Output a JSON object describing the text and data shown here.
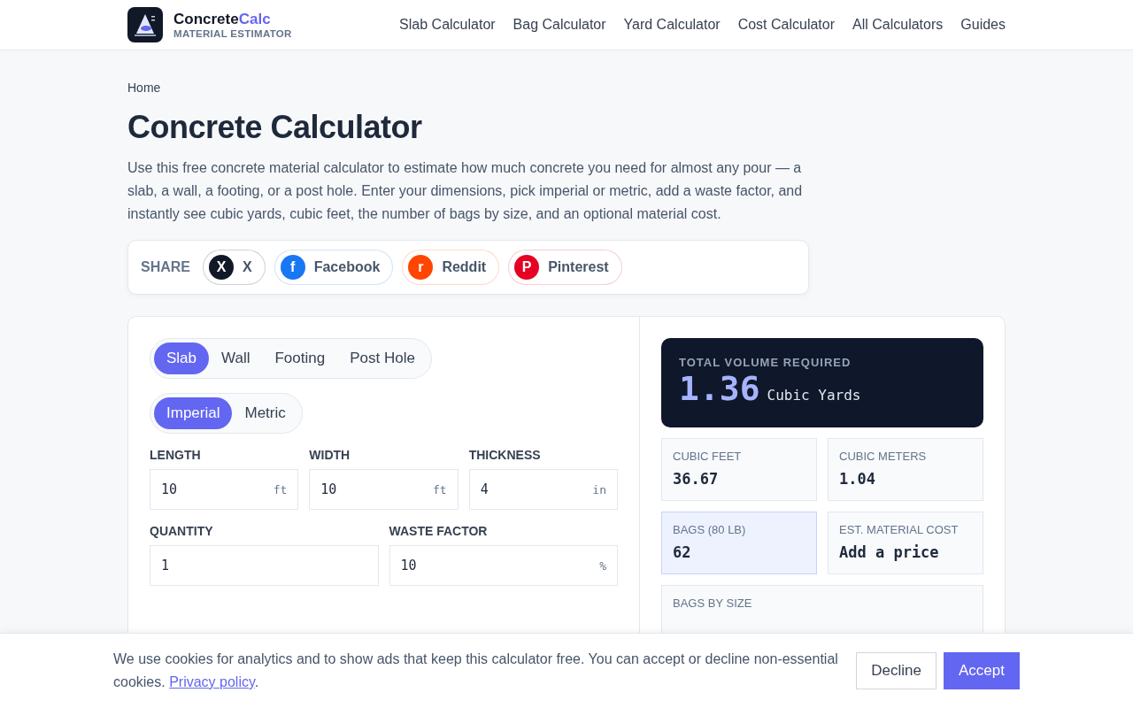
{
  "header": {
    "brand": {
      "name": "Concrete",
      "accent": "Calc",
      "tagline": "MATERIAL ESTIMATOR"
    },
    "nav": [
      {
        "label": "Slab Calculator"
      },
      {
        "label": "Bag Calculator"
      },
      {
        "label": "Yard Calculator"
      },
      {
        "label": "Cost Calculator"
      },
      {
        "label": "All Calculators"
      },
      {
        "label": "Guides"
      }
    ]
  },
  "breadcrumb": "Home",
  "title": "Concrete Calculator",
  "intro": "Use this free concrete material calculator to estimate how much concrete you need for almost any pour — a slab, a wall, a footing, or a post hole. Enter your dimensions, pick imperial or metric, add a waste factor, and instantly see cubic yards, cubic feet, the number of bags by size, and an optional material cost.",
  "share": {
    "label": "SHARE",
    "buttons": [
      {
        "glyph": "X",
        "label": "X",
        "color": "#111827"
      },
      {
        "glyph": "f",
        "label": "Facebook",
        "color": "#1877f2"
      },
      {
        "glyph": "r",
        "label": "Reddit",
        "color": "#ff4500"
      },
      {
        "glyph": "P",
        "label": "Pinterest",
        "color": "#e60023"
      }
    ]
  },
  "calculator": {
    "shape_tabs": [
      {
        "label": "Slab",
        "selected": true
      },
      {
        "label": "Wall",
        "selected": false
      },
      {
        "label": "Footing",
        "selected": false
      },
      {
        "label": "Post Hole",
        "selected": false
      }
    ],
    "unit_tabs": [
      {
        "label": "Imperial",
        "selected": true
      },
      {
        "label": "Metric",
        "selected": false
      }
    ],
    "field_rows": [
      [
        {
          "label": "LENGTH",
          "value": "10",
          "unit": "ft"
        },
        {
          "label": "WIDTH",
          "value": "10",
          "unit": "ft"
        },
        {
          "label": "THICKNESS",
          "value": "4",
          "unit": "in"
        }
      ],
      [
        {
          "label": "QUANTITY",
          "value": "1"
        },
        {
          "label": "WASTE FACTOR",
          "value": "10",
          "unit": "%"
        }
      ]
    ],
    "total": {
      "label": "TOTAL VOLUME REQUIRED",
      "value": "1.36",
      "unit": "Cubic Yards"
    },
    "stats": [
      {
        "label": "CUBIC FEET",
        "value": "36.67",
        "highlighted": false
      },
      {
        "label": "CUBIC METERS",
        "value": "1.04",
        "highlighted": false
      },
      {
        "label": "BAGS (80 LB)",
        "value": "62",
        "highlighted": true
      },
      {
        "label": "EST. MATERIAL COST",
        "value": "Add a price",
        "highlighted": false
      }
    ],
    "bags_by_size": {
      "label": "BAGS BY SIZE"
    }
  },
  "cookie_banner": {
    "text": "We use cookies for analytics and to show ads that keep this calculator free. You can accept or decline non-essential cookies. ",
    "link": "Privacy policy",
    "after": ".",
    "buttons": [
      {
        "label": "Decline",
        "kind": "secondary"
      },
      {
        "label": "Accept",
        "kind": "primary"
      }
    ]
  }
}
